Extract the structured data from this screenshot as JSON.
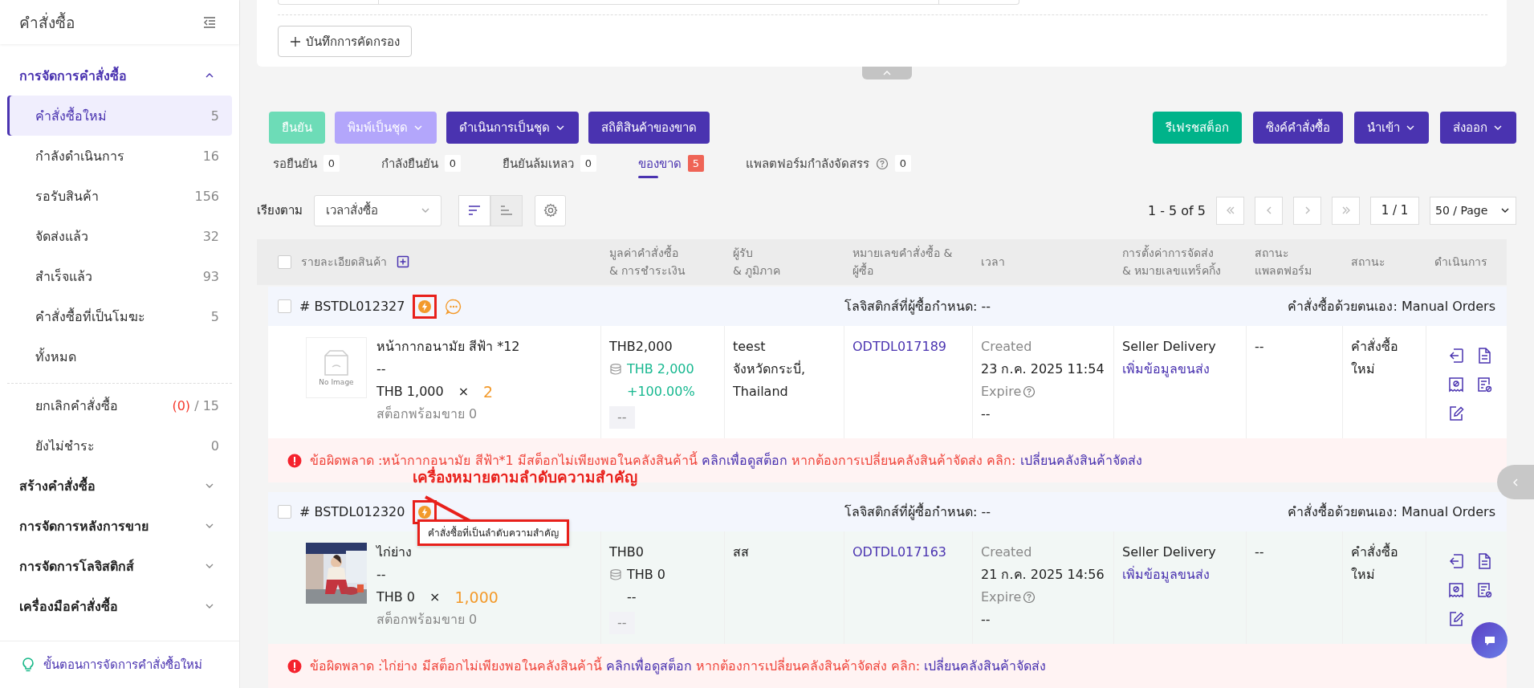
{
  "sidebar": {
    "title": "คำสั่งซื้อ",
    "groups": [
      {
        "label": "การจัดการคำสั่งซื้อ",
        "expanded": true,
        "items": [
          {
            "label": "คำสั่งซื้อใหม่",
            "count": "5",
            "selected": true
          },
          {
            "label": "กำลังดำเนินการ",
            "count": "16",
            "selected": false
          },
          {
            "label": "รอรับสินค้า",
            "count": "156",
            "selected": false
          },
          {
            "label": "จัดส่งแล้ว",
            "count": "32",
            "selected": false
          },
          {
            "label": "สำเร็จแล้ว",
            "count": "93",
            "selected": false
          },
          {
            "label": "คำสั่งซื้อที่เป็นโมฆะ",
            "count": "5",
            "selected": false
          },
          {
            "label": "ทั้งหมด",
            "selected": false
          }
        ],
        "more_items": [
          {
            "label": "ยกเลิกคำสั่งซื้อ",
            "alert_count": "(0)",
            "count": "/ 15",
            "selected": false
          },
          {
            "label": "ยังไม่ชำระ",
            "count": "0",
            "selected": false
          }
        ]
      },
      {
        "label": "สร้างคำสั่งซื้อ",
        "expanded": false
      },
      {
        "label": "การจัดการหลังการขาย",
        "expanded": false
      },
      {
        "label": "การจัดการโลจิสติกส์",
        "expanded": false
      },
      {
        "label": "เครื่องมือคำสั่งซื้อ",
        "expanded": false
      }
    ],
    "footer_link": "ขั้นตอนการจัดการคำสั่งซื้อใหม่"
  },
  "filter_panel": {
    "save_filter_button": "บันทึกการคัดกรอง"
  },
  "actions_left": [
    {
      "label": "ยืนยัน",
      "kind": "success",
      "disabled": true,
      "dropdown": false
    },
    {
      "label": "พิมพ์เป็นชุด",
      "kind": "primary",
      "disabled": true,
      "dropdown": true
    },
    {
      "label": "ดำเนินการเป็นชุด",
      "kind": "primary",
      "disabled": false,
      "dropdown": true
    },
    {
      "label": "สถิติสินค้าของขาด",
      "kind": "primary",
      "disabled": false,
      "dropdown": false
    }
  ],
  "actions_right": [
    {
      "label": "รีเฟรชสต็อก",
      "kind": "success",
      "disabled": false,
      "dropdown": false
    },
    {
      "label": "ซิงค์คำสั่งซื้อ",
      "kind": "primary",
      "disabled": false,
      "dropdown": false
    },
    {
      "label": "นำเข้า",
      "kind": "primary",
      "disabled": false,
      "dropdown": true
    },
    {
      "label": "ส่งออก",
      "kind": "primary",
      "disabled": false,
      "dropdown": true
    }
  ],
  "status_tabs": [
    {
      "label": "รอยืนยัน",
      "count": "0",
      "selected": false,
      "help": false
    },
    {
      "label": "กำลังยืนยัน",
      "count": "0",
      "selected": false,
      "help": false
    },
    {
      "label": "ยืนยันล้มเหลว",
      "count": "0",
      "selected": false,
      "help": false
    },
    {
      "label": "ของขาด",
      "count": "5",
      "selected": true,
      "help": false
    },
    {
      "label": "แพลตฟอร์มกำลังจัดสรร",
      "count": "0",
      "selected": false,
      "help": true
    }
  ],
  "sort": {
    "label": "เรียงตาม",
    "value": "เวลาสั่งซื้อ",
    "direction_buttons": [
      {
        "kind": "descending",
        "selected": true
      },
      {
        "kind": "ascending",
        "selected": false
      }
    ]
  },
  "pagination": {
    "range": "1 - 5 of 5",
    "page": "1 / 1",
    "page_size": "50 / Page"
  },
  "table": {
    "select_all_checked": false,
    "columns": [
      {
        "lines": [
          "รายละเอียดสินค้า"
        ]
      },
      {
        "lines": [
          "มูลค่าคำสั่งซื้อ",
          "& การชำระเงิน"
        ]
      },
      {
        "lines": [
          "ผู้รับ",
          "& ภูมิภาค"
        ]
      },
      {
        "lines": [
          "หมายเลขคำสั่งซื้อ &",
          "ผู้ซื้อ"
        ]
      },
      {
        "lines": [
          "เวลา"
        ]
      },
      {
        "lines": [
          "การตั้งค่าการจัดส่ง",
          "& หมายเลขแทร็คกิ้ง"
        ]
      },
      {
        "lines": [
          "สถานะ",
          "แพลตฟอร์ม"
        ]
      },
      {
        "lines": [
          "สถานะ"
        ]
      },
      {
        "lines": [
          "ดำเนินการ"
        ]
      }
    ],
    "orders": [
      {
        "number": "# BSTDL012327",
        "checked": false,
        "priority": true,
        "marked": true,
        "has_note": true,
        "hovered": false,
        "logistics": "โลจิสติกส์ที่ผู้ซื้อกำหนด: --",
        "source": "คำสั่งซื้อด้วยตนเอง: Manual Orders",
        "product": {
          "image": {
            "kind": "placeholder",
            "label": "No Image"
          },
          "name": "หน้ากากอนามัย สีฟ้า *12",
          "variant": "--",
          "price": "THB 1,000",
          "times": "×",
          "quantity": "2",
          "stock": "สต็อกพร้อมขาย 0"
        },
        "value": {
          "total": "THB2,000",
          "paid": "THB 2,000",
          "change": "+100.00%",
          "positive": true,
          "note": "--"
        },
        "recipient": [
          "teest",
          "จังหวัดกระบี่,",
          "Thailand"
        ],
        "order_no": "ODTDL017189",
        "time": {
          "created_label": "Created",
          "created": "23 ก.ค. 2025 11:54",
          "expire_label": "Expire",
          "expire": "--"
        },
        "shipping": {
          "method": "Seller Delivery",
          "link": "เพิ่มข้อมูลขนส่ง"
        },
        "platform_status": "--",
        "status": [
          "คำสั่งซื้อ",
          "ใหม่"
        ],
        "error": {
          "text": "ข้อผิดพลาด :หน้ากากอนามัย สีฟ้า*1 มีสต็อกไม่เพียงพอในคลังสินค้านี้",
          "link": "คลิกเพื่อดูสต็อก",
          "text2": "หากต้องการเปลี่ยนคลังสินค้าจัดส่ง คลิก:",
          "link2": "เปลี่ยนคลังสินค้าจัดส่ง"
        }
      },
      {
        "number": "# BSTDL012320",
        "checked": false,
        "priority": true,
        "marked": true,
        "has_note": false,
        "hovered": true,
        "logistics": "โลจิสติกส์ที่ผู้ซื้อกำหนด: --",
        "source": "คำสั่งซื้อด้วยตนเอง: Manual Orders",
        "annotation": {
          "label": "เครื่องหมายตามลำดับความสำคัญ",
          "tooltip": "คำสั่งซื้อที่เป็นลำดับความสำคัญ"
        },
        "product": {
          "name": "ไก่ย่าง",
          "variant": "--",
          "price": "THB 0",
          "times": "×",
          "quantity": "1,000",
          "stock": "สต็อกพร้อมขาย 0"
        },
        "value": {
          "total": "THB0",
          "paid": "THB 0",
          "change": "--",
          "positive": false,
          "note": "--"
        },
        "recipient": [
          "สส"
        ],
        "order_no": "ODTDL017163",
        "time": {
          "created_label": "Created",
          "created": "21 ก.ค. 2025 14:56",
          "expire_label": "Expire",
          "expire": "--"
        },
        "shipping": {
          "method": "Seller Delivery",
          "link": "เพิ่มข้อมูลขนส่ง"
        },
        "platform_status": "--",
        "status": [
          "คำสั่งซื้อ",
          "ใหม่"
        ],
        "error": {
          "text": "ข้อผิดพลาด :ไก่ย่าง มีสต็อกไม่เพียงพอในคลังสินค้านี้",
          "link": "คลิกเพื่อดูสต็อก",
          "text2": "หากต้องการเปลี่ยนคลังสินค้าจัดส่ง คลิก:",
          "link2": "เปลี่ยนคลังสินค้าจัดส่ง"
        }
      }
    ]
  }
}
